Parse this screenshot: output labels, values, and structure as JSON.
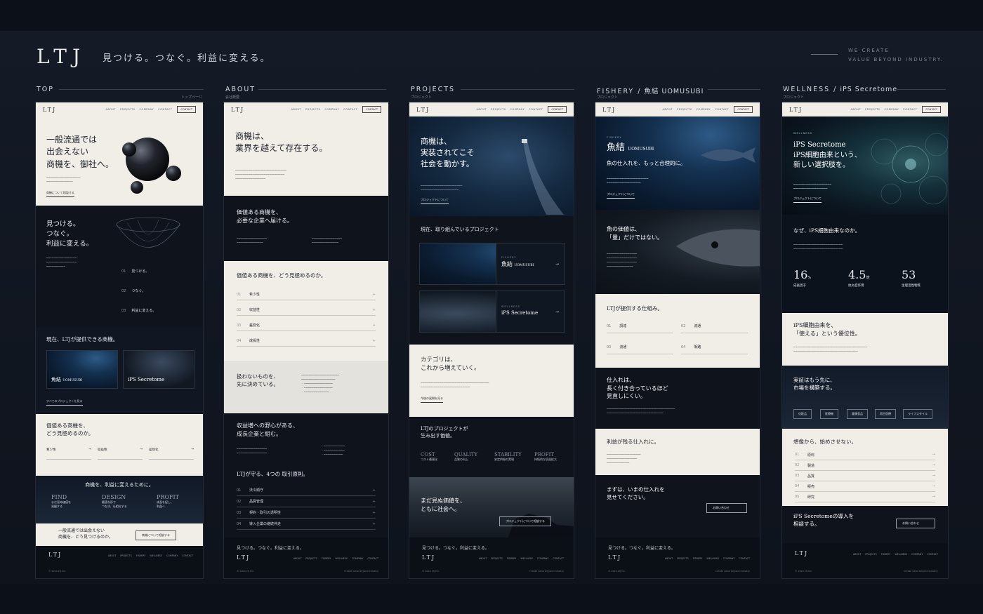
{
  "header": {
    "brand": "LTJ",
    "tagline": "見つける。つなぐ。利益に変える。",
    "we_line1": "WE CREATE",
    "we_line2": "VALUE BEYOND INDUSTRY."
  },
  "columns": [
    {
      "label": "TOP",
      "sub": "",
      "note": "トップページ"
    },
    {
      "label": "ABOUT",
      "sub": "",
      "note": "会社概要"
    },
    {
      "label": "PROJECTS",
      "sub": "",
      "note": "プロジェクト"
    },
    {
      "label": "FISHERY /",
      "sub": "魚結 UOMUSUBI",
      "note": "プロジェクト"
    },
    {
      "label": "WELLNESS /",
      "sub": "iPS Secretome",
      "note": "プロジェクト"
    }
  ],
  "nav": {
    "logo": "LTJ",
    "about": "ABOUT",
    "projects": "PROJECTS",
    "company": "COMPANY",
    "contact": "CONTACT",
    "contact_btn": "CONTACT"
  },
  "top": {
    "hero_l1": "一般流通では",
    "hero_l2": "出会えない",
    "hero_l3": "商機を、御社へ。",
    "hero_link": "商機について相談する",
    "s2_l1": "見つける。",
    "s2_l2": "つなぐ。",
    "s2_l3": "利益に変える。",
    "steps": [
      {
        "n": "01",
        "t": "見つける。"
      },
      {
        "n": "02",
        "t": "つなぐ。"
      },
      {
        "n": "03",
        "t": "利益に変える。"
      }
    ],
    "s3_title": "現在、LTJが提供できる商機。",
    "card1_title": "魚結",
    "card1_sub": "UOMUSUBI",
    "card2_title": "iPS Secretome",
    "s3_link": "すべてのプロジェクトを見る",
    "s4_l1": "価値ある商機を、",
    "s4_l2": "どう見極めるのか。",
    "s4_items": [
      "希少性",
      "収益性",
      "差別化"
    ],
    "s5_title": "商機を、利益に変えるために。",
    "s5_cols": [
      {
        "en": "FIND",
        "jp1": "まだ見ぬ価値を",
        "jp2": "発掘する"
      },
      {
        "en": "DESIGN",
        "jp1": "最適な形で",
        "jp2": "つなぎ、仕組化する"
      },
      {
        "en": "PROFIT",
        "jp1": "成長を促し、",
        "jp2": "利益へ"
      }
    ],
    "cta_l1": "一般流通では出会えない",
    "cta_l2": "商機を、どう見つけるのか。",
    "cta_btn": "商機について相談する",
    "footer_msg": "",
    "footer_copy": "© 2024 LTJ Inc."
  },
  "about": {
    "hero_l1": "商機は、",
    "hero_l2": "業界を越えて存在する。",
    "s2_l1": "価値ある商機を、",
    "s2_l2": "必要な企業へ届ける。",
    "s3_title": "価値ある商機を、どう見極めるのか。",
    "s3_items": [
      {
        "n": "01",
        "t": "希少性"
      },
      {
        "n": "02",
        "t": "収益性"
      },
      {
        "n": "03",
        "t": "差別化"
      },
      {
        "n": "04",
        "t": "成長性"
      }
    ],
    "s4_l1": "扱わないものを、",
    "s4_l2": "先に決めている。",
    "s5_l1": "収益増への野心がある、",
    "s5_l2": "成長企業と組む。",
    "s6_title": "LTJが守る、4つの 取引原則。",
    "s6_items": [
      {
        "n": "01",
        "t": "法令順守"
      },
      {
        "n": "02",
        "t": "品質管理"
      },
      {
        "n": "03",
        "t": "契約・取引の透明性"
      },
      {
        "n": "04",
        "t": "導入企業の継続伴走"
      }
    ],
    "footer_msg": "見つける。つなぐ。利益に変える。",
    "footer_copy": "© 2024 LTJ Inc.",
    "footer_copy2": "Create value beyond industry"
  },
  "projects": {
    "hero_l1": "商機は、",
    "hero_l2": "実装されてこそ",
    "hero_l3": "社会を動かす。",
    "hero_link": "プロジェクトについて",
    "s2_title": "現在、取り組んでいるプロジェクト",
    "p1_label": "FISHERY",
    "p1_title": "魚結",
    "p1_sub": "UOMUSUBI",
    "p2_label": "WELLNESS",
    "p2_title": "iPS Secretome",
    "s3_l1": "カテゴリは、",
    "s3_l2": "これから増えていく。",
    "s3_link": "今後の展開を見る",
    "s4_l1": "LTJのプロジェクトが",
    "s4_l2": "生み出す価値。",
    "values": [
      {
        "en": "COST",
        "jp": "コスト最適化"
      },
      {
        "en": "QUALITY",
        "jp": "品質の向上"
      },
      {
        "en": "STABILITY",
        "jp": "安定供給の実現"
      },
      {
        "en": "PROFIT",
        "jp": "持続的な収益拡大"
      }
    ],
    "s5_l1": "まだ見ぬ価値を、",
    "s5_l2": "ともに社会へ。",
    "s5_btn": "プロジェクトについて相談する",
    "footer_msg": "見つける。つなぐ。利益に変える。",
    "footer_copy": "© 2024 LTJ Inc.",
    "footer_copy2": "Create value beyond industry"
  },
  "fishery": {
    "label": "FISHERY",
    "hero_title": "魚結",
    "hero_sub": "UOMUSUBI",
    "hero_l2": "魚の仕入れを、もっと合理的に。",
    "hero_link": "プロジェクトについて",
    "s2_l1": "魚の価値は、",
    "s2_l2": "「量」だけではない。",
    "s3_title": "LTJが提供する仕組み。",
    "s3_items": [
      {
        "n": "01",
        "t": "調達"
      },
      {
        "n": "02",
        "t": "流通"
      },
      {
        "n": "03",
        "t": "流通"
      },
      {
        "n": "04",
        "t": "販路"
      }
    ],
    "s4_l1": "仕入れは、",
    "s4_l2": "長く付き合っているほど",
    "s4_l3": "見直しにくい。",
    "s5_title": "利益が残る仕入れに。",
    "s6_l1": "まずは、いまの仕入れを",
    "s6_l2": "見せてください。",
    "s6_btn": "お問い合わせ",
    "footer_msg": "見つける。つなぐ。利益に変える。",
    "footer_copy": "© 2024 LTJ Inc.",
    "footer_copy2": "Create value beyond industry"
  },
  "wellness": {
    "label": "WELLNESS",
    "hero_l1": "iPS Secretome",
    "hero_l2": "iPS細胞由来という、",
    "hero_l3": "新しい選択肢を。",
    "hero_link": "プロジェクトについて",
    "s2_title": "なぜ、iPS細胞由来なのか。",
    "stats": [
      {
        "num": "16",
        "unit": "%",
        "lab": "成長因子"
      },
      {
        "num": "4.5",
        "unit": "倍",
        "lab": "抗炎症作用"
      },
      {
        "num": "53",
        "unit": "",
        "lab": "生理活性物質"
      }
    ],
    "s3_l1": "iPS細胞由来を、",
    "s3_l2": "「使える」という優位性。",
    "s4_l1": "実証はもう先に、",
    "s4_l2": "市場を構築する。",
    "tags": [
      "化粧品",
      "医療機",
      "健康食品",
      "再生医療",
      "ライフスタイル"
    ],
    "s5_title": "想像から、始めさせない。",
    "s5_items": [
      {
        "n": "01",
        "t": "原料"
      },
      {
        "n": "02",
        "t": "製造"
      },
      {
        "n": "03",
        "t": "品質"
      },
      {
        "n": "04",
        "t": "販売"
      },
      {
        "n": "05",
        "t": "研究"
      }
    ],
    "s6_l1": "iPS Secretomeの導入を",
    "s6_l2": "相談する。",
    "s6_btn": "お問い合わせ",
    "footer_msg": "",
    "footer_copy": "© 2024 LTJ Inc.",
    "footer_copy2": "Create value beyond industry"
  },
  "footer_links": [
    "ABOUT",
    "PROJECTS",
    "FISHERY",
    "WELLNESS",
    "COMPANY",
    "CONTACT"
  ]
}
